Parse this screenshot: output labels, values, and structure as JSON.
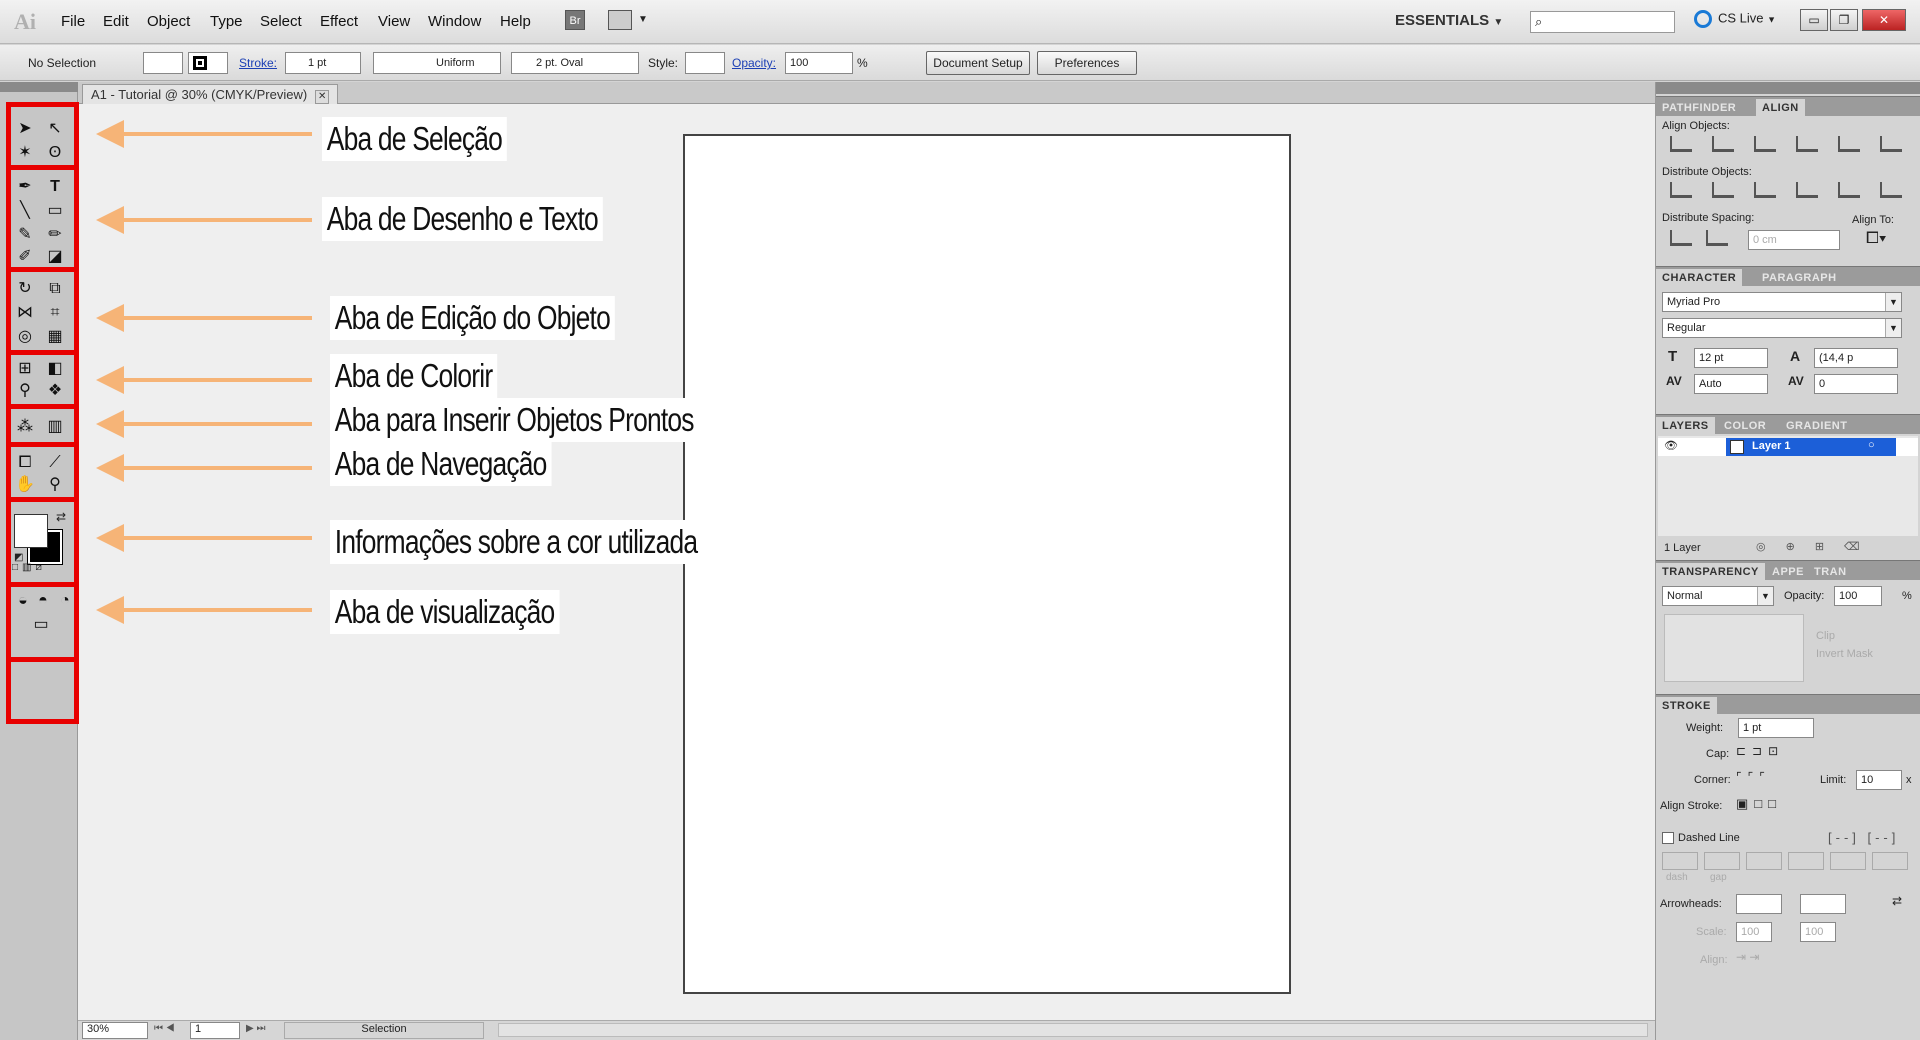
{
  "app": {
    "logo": "Ai",
    "workspace": "ESSENTIALS",
    "cslive": "CS Live",
    "br": "Br"
  },
  "menu": [
    "File",
    "Edit",
    "Object",
    "Type",
    "Select",
    "Effect",
    "View",
    "Window",
    "Help"
  ],
  "window_controls": {
    "minimize": "▭",
    "restore": "❐",
    "close": "✕"
  },
  "control_bar": {
    "selection": "No Selection",
    "stroke_label": "Stroke:",
    "stroke_value": "1 pt",
    "profile": "Uniform",
    "brush": "2 pt. Oval",
    "style_label": "Style:",
    "opacity_label": "Opacity:",
    "opacity_value": "100",
    "opacity_unit": "%",
    "doc_setup": "Document Setup",
    "preferences": "Preferences"
  },
  "document": {
    "tab_title": "A1 - Tutorial @ 30% (CMYK/Preview)",
    "close": "✕"
  },
  "annotations": [
    "Aba de Seleção",
    "Aba de Desenho e Texto",
    "Aba de Edição do Objeto",
    "Aba de Colorir",
    "Aba para Inserir Objetos Prontos",
    "Aba de Navegação",
    "Informações sobre a cor utilizada",
    "Aba de visualização"
  ],
  "status": {
    "zoom": "30%",
    "page": "1",
    "tool": "Selection"
  },
  "panels": {
    "align": {
      "tabs": [
        "PATHFINDER",
        "ALIGN"
      ],
      "align_objects": "Align Objects:",
      "distribute_objects": "Distribute Objects:",
      "distribute_spacing": "Distribute Spacing:",
      "align_to": "Align To:",
      "spacing_value": "0 cm"
    },
    "character": {
      "tabs": [
        "CHARACTER",
        "PARAGRAPH"
      ],
      "font": "Myriad Pro",
      "style": "Regular",
      "size": "12 pt",
      "leading": "(14,4 p",
      "kerning": "Auto",
      "tracking": "0"
    },
    "layers": {
      "tabs": [
        "LAYERS",
        "COLOR",
        "GRADIENT"
      ],
      "layer_name": "Layer 1",
      "count": "1 Layer"
    },
    "transparency": {
      "tabs": [
        "TRANSPARENCY",
        "APPE",
        "TRAN"
      ],
      "mode": "Normal",
      "opacity_label": "Opacity:",
      "opacity": "100",
      "unit": "%",
      "clip": "Clip",
      "invert": "Invert Mask"
    },
    "stroke": {
      "tab": "STROKE",
      "weight_label": "Weight:",
      "weight": "1 pt",
      "cap": "Cap:",
      "corner": "Corner:",
      "limit_label": "Limit:",
      "limit": "10",
      "x": "x",
      "align_stroke": "Align Stroke:",
      "dashed": "Dashed Line",
      "dash": "dash",
      "gap": "gap",
      "arrowheads": "Arrowheads:",
      "scale": "Scale:",
      "scale1": "100",
      "scale2": "100",
      "align": "Align:"
    }
  },
  "colors": {
    "highlight": "#e80000",
    "arrow": "#f6b477",
    "layer_select": "#1c5fd8"
  }
}
